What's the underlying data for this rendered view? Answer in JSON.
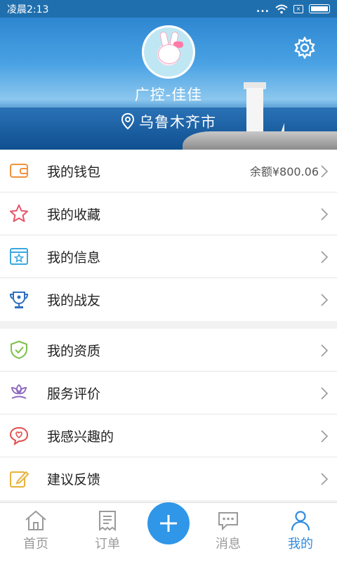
{
  "status_bar": {
    "time": "凌晨2:13",
    "dots": "...",
    "sim": "×"
  },
  "profile": {
    "name": "广控-佳佳",
    "city": "乌鲁木齐市"
  },
  "menu_group_1": [
    {
      "label": "我的钱包",
      "value": "余额¥800.06",
      "icon": "wallet-icon",
      "color": "#f0913f"
    },
    {
      "label": "我的收藏",
      "icon": "star-icon",
      "color": "#e6556a"
    },
    {
      "label": "我的信息",
      "icon": "info-card-icon",
      "color": "#3aa7e0"
    },
    {
      "label": "我的战友",
      "icon": "trophy-icon",
      "color": "#2e6fbf"
    }
  ],
  "menu_group_2": [
    {
      "label": "我的资质",
      "icon": "shield-check-icon",
      "color": "#7cc04b"
    },
    {
      "label": "服务评价",
      "icon": "flower-icon",
      "color": "#8e6bbf"
    },
    {
      "label": "我感兴趣的",
      "icon": "heart-chat-icon",
      "color": "#e24f4f"
    },
    {
      "label": "建议反馈",
      "icon": "edit-icon",
      "color": "#e8b23a"
    }
  ],
  "bottom_nav": {
    "home": "首页",
    "orders": "订单",
    "messages": "消息",
    "mine": "我的"
  },
  "colors": {
    "accent": "#2f8be0",
    "inactive": "#9a9a9a"
  }
}
